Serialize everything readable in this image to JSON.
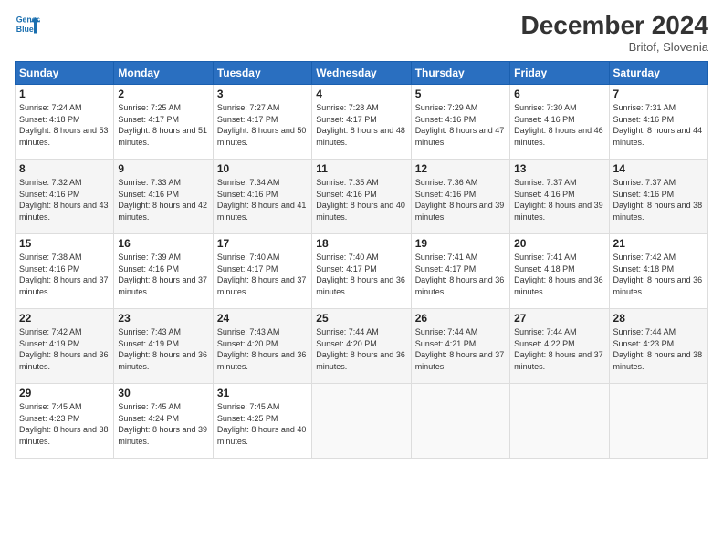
{
  "header": {
    "logo_line1": "General",
    "logo_line2": "Blue",
    "month": "December 2024",
    "location": "Britof, Slovenia"
  },
  "weekdays": [
    "Sunday",
    "Monday",
    "Tuesday",
    "Wednesday",
    "Thursday",
    "Friday",
    "Saturday"
  ],
  "weeks": [
    [
      {
        "day": "1",
        "sunrise": "Sunrise: 7:24 AM",
        "sunset": "Sunset: 4:18 PM",
        "daylight": "Daylight: 8 hours and 53 minutes."
      },
      {
        "day": "2",
        "sunrise": "Sunrise: 7:25 AM",
        "sunset": "Sunset: 4:17 PM",
        "daylight": "Daylight: 8 hours and 51 minutes."
      },
      {
        "day": "3",
        "sunrise": "Sunrise: 7:27 AM",
        "sunset": "Sunset: 4:17 PM",
        "daylight": "Daylight: 8 hours and 50 minutes."
      },
      {
        "day": "4",
        "sunrise": "Sunrise: 7:28 AM",
        "sunset": "Sunset: 4:17 PM",
        "daylight": "Daylight: 8 hours and 48 minutes."
      },
      {
        "day": "5",
        "sunrise": "Sunrise: 7:29 AM",
        "sunset": "Sunset: 4:16 PM",
        "daylight": "Daylight: 8 hours and 47 minutes."
      },
      {
        "day": "6",
        "sunrise": "Sunrise: 7:30 AM",
        "sunset": "Sunset: 4:16 PM",
        "daylight": "Daylight: 8 hours and 46 minutes."
      },
      {
        "day": "7",
        "sunrise": "Sunrise: 7:31 AM",
        "sunset": "Sunset: 4:16 PM",
        "daylight": "Daylight: 8 hours and 44 minutes."
      }
    ],
    [
      {
        "day": "8",
        "sunrise": "Sunrise: 7:32 AM",
        "sunset": "Sunset: 4:16 PM",
        "daylight": "Daylight: 8 hours and 43 minutes."
      },
      {
        "day": "9",
        "sunrise": "Sunrise: 7:33 AM",
        "sunset": "Sunset: 4:16 PM",
        "daylight": "Daylight: 8 hours and 42 minutes."
      },
      {
        "day": "10",
        "sunrise": "Sunrise: 7:34 AM",
        "sunset": "Sunset: 4:16 PM",
        "daylight": "Daylight: 8 hours and 41 minutes."
      },
      {
        "day": "11",
        "sunrise": "Sunrise: 7:35 AM",
        "sunset": "Sunset: 4:16 PM",
        "daylight": "Daylight: 8 hours and 40 minutes."
      },
      {
        "day": "12",
        "sunrise": "Sunrise: 7:36 AM",
        "sunset": "Sunset: 4:16 PM",
        "daylight": "Daylight: 8 hours and 39 minutes."
      },
      {
        "day": "13",
        "sunrise": "Sunrise: 7:37 AM",
        "sunset": "Sunset: 4:16 PM",
        "daylight": "Daylight: 8 hours and 39 minutes."
      },
      {
        "day": "14",
        "sunrise": "Sunrise: 7:37 AM",
        "sunset": "Sunset: 4:16 PM",
        "daylight": "Daylight: 8 hours and 38 minutes."
      }
    ],
    [
      {
        "day": "15",
        "sunrise": "Sunrise: 7:38 AM",
        "sunset": "Sunset: 4:16 PM",
        "daylight": "Daylight: 8 hours and 37 minutes."
      },
      {
        "day": "16",
        "sunrise": "Sunrise: 7:39 AM",
        "sunset": "Sunset: 4:16 PM",
        "daylight": "Daylight: 8 hours and 37 minutes."
      },
      {
        "day": "17",
        "sunrise": "Sunrise: 7:40 AM",
        "sunset": "Sunset: 4:17 PM",
        "daylight": "Daylight: 8 hours and 37 minutes."
      },
      {
        "day": "18",
        "sunrise": "Sunrise: 7:40 AM",
        "sunset": "Sunset: 4:17 PM",
        "daylight": "Daylight: 8 hours and 36 minutes."
      },
      {
        "day": "19",
        "sunrise": "Sunrise: 7:41 AM",
        "sunset": "Sunset: 4:17 PM",
        "daylight": "Daylight: 8 hours and 36 minutes."
      },
      {
        "day": "20",
        "sunrise": "Sunrise: 7:41 AM",
        "sunset": "Sunset: 4:18 PM",
        "daylight": "Daylight: 8 hours and 36 minutes."
      },
      {
        "day": "21",
        "sunrise": "Sunrise: 7:42 AM",
        "sunset": "Sunset: 4:18 PM",
        "daylight": "Daylight: 8 hours and 36 minutes."
      }
    ],
    [
      {
        "day": "22",
        "sunrise": "Sunrise: 7:42 AM",
        "sunset": "Sunset: 4:19 PM",
        "daylight": "Daylight: 8 hours and 36 minutes."
      },
      {
        "day": "23",
        "sunrise": "Sunrise: 7:43 AM",
        "sunset": "Sunset: 4:19 PM",
        "daylight": "Daylight: 8 hours and 36 minutes."
      },
      {
        "day": "24",
        "sunrise": "Sunrise: 7:43 AM",
        "sunset": "Sunset: 4:20 PM",
        "daylight": "Daylight: 8 hours and 36 minutes."
      },
      {
        "day": "25",
        "sunrise": "Sunrise: 7:44 AM",
        "sunset": "Sunset: 4:20 PM",
        "daylight": "Daylight: 8 hours and 36 minutes."
      },
      {
        "day": "26",
        "sunrise": "Sunrise: 7:44 AM",
        "sunset": "Sunset: 4:21 PM",
        "daylight": "Daylight: 8 hours and 37 minutes."
      },
      {
        "day": "27",
        "sunrise": "Sunrise: 7:44 AM",
        "sunset": "Sunset: 4:22 PM",
        "daylight": "Daylight: 8 hours and 37 minutes."
      },
      {
        "day": "28",
        "sunrise": "Sunrise: 7:44 AM",
        "sunset": "Sunset: 4:23 PM",
        "daylight": "Daylight: 8 hours and 38 minutes."
      }
    ],
    [
      {
        "day": "29",
        "sunrise": "Sunrise: 7:45 AM",
        "sunset": "Sunset: 4:23 PM",
        "daylight": "Daylight: 8 hours and 38 minutes."
      },
      {
        "day": "30",
        "sunrise": "Sunrise: 7:45 AM",
        "sunset": "Sunset: 4:24 PM",
        "daylight": "Daylight: 8 hours and 39 minutes."
      },
      {
        "day": "31",
        "sunrise": "Sunrise: 7:45 AM",
        "sunset": "Sunset: 4:25 PM",
        "daylight": "Daylight: 8 hours and 40 minutes."
      },
      null,
      null,
      null,
      null
    ]
  ]
}
